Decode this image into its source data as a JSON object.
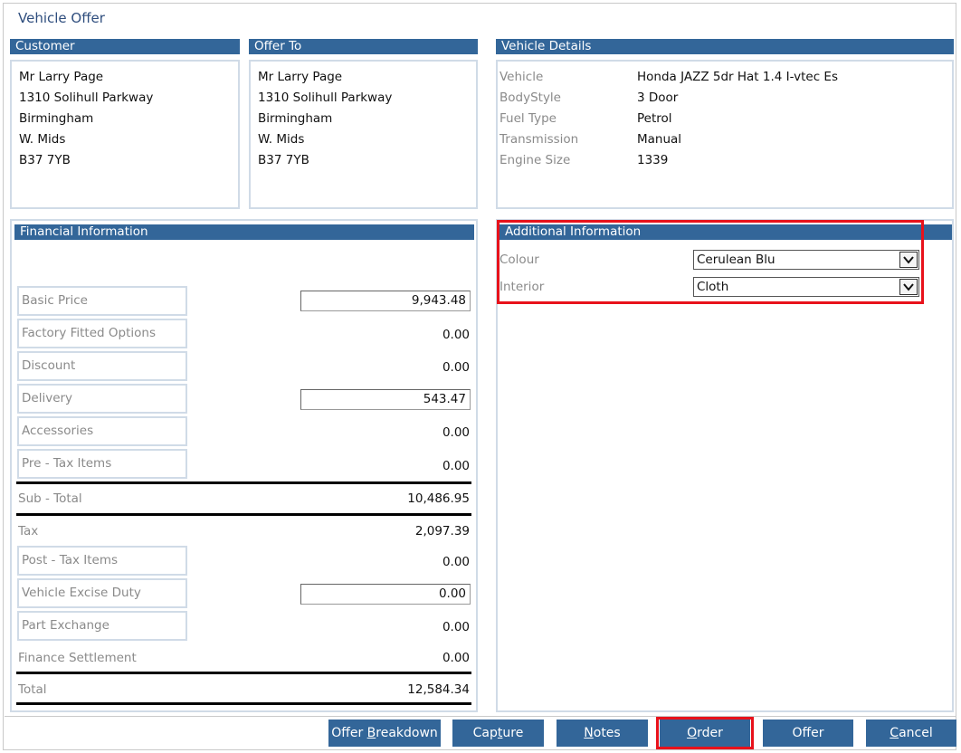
{
  "window": {
    "title": "Vehicle Offer"
  },
  "customer": {
    "header": "Customer",
    "lines": [
      "Mr Larry Page",
      "1310 Solihull Parkway",
      "Birmingham",
      "W. Mids",
      "B37 7YB"
    ]
  },
  "offer_to": {
    "header": "Offer To",
    "lines": [
      "Mr Larry Page",
      "1310 Solihull Parkway",
      "Birmingham",
      "W. Mids",
      "B37 7YB"
    ]
  },
  "vehicle_details": {
    "header": "Vehicle Details",
    "rows": [
      {
        "label": "Vehicle",
        "value": "Honda JAZZ 5dr Hat 1.4 I-vtec Es"
      },
      {
        "label": "BodyStyle",
        "value": "3 Door"
      },
      {
        "label": "Fuel Type",
        "value": "Petrol"
      },
      {
        "label": "Transmission",
        "value": "Manual"
      },
      {
        "label": "Engine Size",
        "value": "1339"
      }
    ]
  },
  "financial": {
    "header": "Financial Information",
    "basic_price": {
      "label": "Basic Price",
      "value": "9,943.48"
    },
    "factory_options": {
      "label": "Factory Fitted Options",
      "value": "0.00"
    },
    "discount": {
      "label": "Discount",
      "value": "0.00"
    },
    "delivery": {
      "label": "Delivery",
      "value": "543.47"
    },
    "accessories": {
      "label": "Accessories",
      "value": "0.00"
    },
    "pre_tax": {
      "label": "Pre - Tax Items",
      "value": "0.00"
    },
    "sub_total": {
      "label": "Sub - Total",
      "value": "10,486.95"
    },
    "tax": {
      "label": "Tax",
      "value": "2,097.39"
    },
    "post_tax": {
      "label": "Post - Tax Items",
      "value": "0.00"
    },
    "excise": {
      "label": "Vehicle Excise Duty",
      "value": "0.00"
    },
    "part_exchange": {
      "label": "Part Exchange",
      "value": "0.00"
    },
    "finance_settlement": {
      "label": "Finance Settlement",
      "value": "0.00"
    },
    "total": {
      "label": "Total",
      "value": "12,584.34"
    }
  },
  "additional": {
    "header": "Additional Information",
    "colour": {
      "label": "Colour",
      "value": "Cerulean Blu"
    },
    "interior": {
      "label": "Interior",
      "value": "Cloth"
    }
  },
  "buttons": {
    "offer_breakdown": {
      "pre": "Offer ",
      "key": "B",
      "post": "reakdown"
    },
    "capture": {
      "pre": "Cap",
      "key": "t",
      "post": "ure"
    },
    "notes": {
      "pre": "",
      "key": "N",
      "post": "otes"
    },
    "order": {
      "pre": "",
      "key": "O",
      "post": "rder"
    },
    "offer": {
      "label": "Offer"
    },
    "cancel": {
      "pre": "",
      "key": "C",
      "post": "ancel"
    }
  },
  "colors": {
    "header_blue": "#336699",
    "highlight_red": "#e8121b",
    "title_blue": "#2f4e7e"
  }
}
